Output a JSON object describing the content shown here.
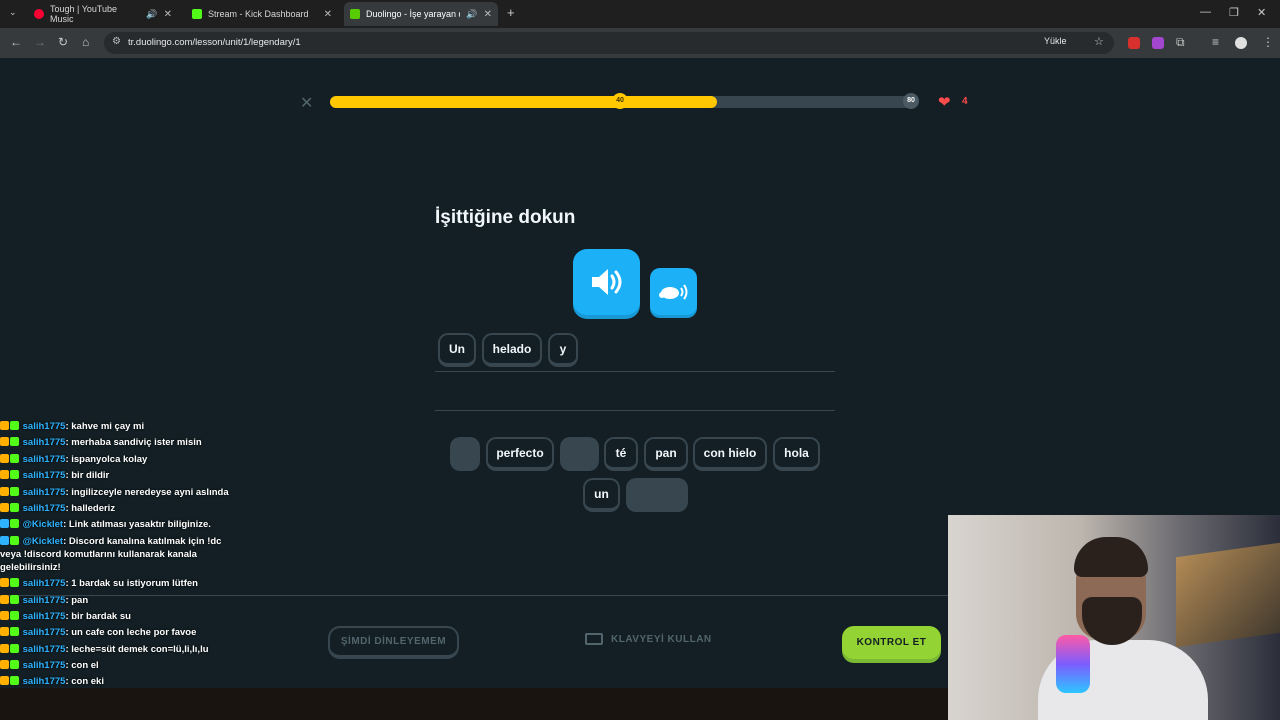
{
  "browser": {
    "tabs": [
      {
        "title": "Tough | YouTube Music",
        "color": "#ff0033",
        "active": false,
        "audio": true
      },
      {
        "title": "Stream - Kick Dashboard",
        "color": "#53fc18",
        "active": false,
        "audio": false
      },
      {
        "title": "Duolingo - İşe yarayan dert",
        "color": "#58cc02",
        "active": true,
        "audio": true
      }
    ],
    "new_tab": "+",
    "url": "tr.duolingo.com/lesson/unit/1/legendary/1",
    "install_label": "Yükle"
  },
  "lesson": {
    "progress": {
      "fraction": 0.66,
      "milestone_mid": "40",
      "milestone_end": "80"
    },
    "hearts": "4",
    "prompt": "İşittiğine dokun",
    "answer_chips": [
      "Un",
      "helado",
      "y"
    ],
    "word_bank": [
      {
        "label": "",
        "used": true
      },
      {
        "label": "perfecto",
        "used": false
      },
      {
        "label": "",
        "used": true
      },
      {
        "label": "té",
        "used": false
      },
      {
        "label": "pan",
        "used": false
      },
      {
        "label": "con hielo",
        "used": false
      },
      {
        "label": "hola",
        "used": false
      },
      {
        "label": "un",
        "used": false
      },
      {
        "label": "",
        "used": true
      }
    ],
    "cant_listen": "ŞİMDİ DİNLEYEMEM",
    "use_keyboard": "KLAVYEYİ KULLAN",
    "check": "KONTROL ET"
  },
  "chat": [
    {
      "user": "salih1775",
      "text": "kahve mi çay mi"
    },
    {
      "user": "salih1775",
      "text": "merhaba sandiviç ister misin"
    },
    {
      "user": "salih1775",
      "text": "ispanyolca kolay"
    },
    {
      "user": "salih1775",
      "text": "bir dildir"
    },
    {
      "user": "salih1775",
      "text": "ingilizceyle neredeyse ayni aslında"
    },
    {
      "user": "salih1775",
      "text": "hallederiz"
    },
    {
      "user": "@Kicklet",
      "text": "Link atılması yasaktır biliginize."
    },
    {
      "user": "@Kicklet",
      "text": "Discord kanalına katılmak için !dc veya !discord komutlarını kullanarak kanala gelebilirsiniz!"
    },
    {
      "user": "salih1775",
      "text": "1 bardak su istiyorum lütfen"
    },
    {
      "user": "salih1775",
      "text": "pan"
    },
    {
      "user": "salih1775",
      "text": "bir bardak su"
    },
    {
      "user": "salih1775",
      "text": "un cafe con leche por favoe"
    },
    {
      "user": "salih1775",
      "text": "leche=süt demek con=lü,li,lı,lu"
    },
    {
      "user": "salih1775",
      "text": "con el"
    },
    {
      "user": "salih1775",
      "text": "con eki"
    }
  ]
}
